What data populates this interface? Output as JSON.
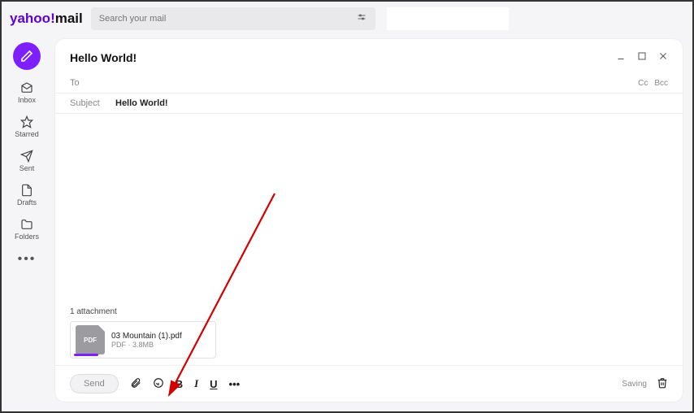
{
  "brand": {
    "y": "yahoo",
    "excl": "!",
    "mail": "mail"
  },
  "search": {
    "placeholder": "Search your mail"
  },
  "sidebar": {
    "items": [
      {
        "label": "Inbox"
      },
      {
        "label": "Starred"
      },
      {
        "label": "Sent"
      },
      {
        "label": "Drafts"
      },
      {
        "label": "Folders"
      }
    ]
  },
  "compose": {
    "title": "Hello World!",
    "to_label": "To",
    "cc_label": "Cc",
    "bcc_label": "Bcc",
    "subject_label": "Subject",
    "subject_value": "Hello World!",
    "attachments_label": "1 attachment",
    "attachment": {
      "name": "03 Mountain (1).pdf",
      "type": "PDF",
      "sep": " · ",
      "size": "3.8MB",
      "badge": "PDF"
    },
    "send_label": "Send",
    "status": "Saving"
  }
}
